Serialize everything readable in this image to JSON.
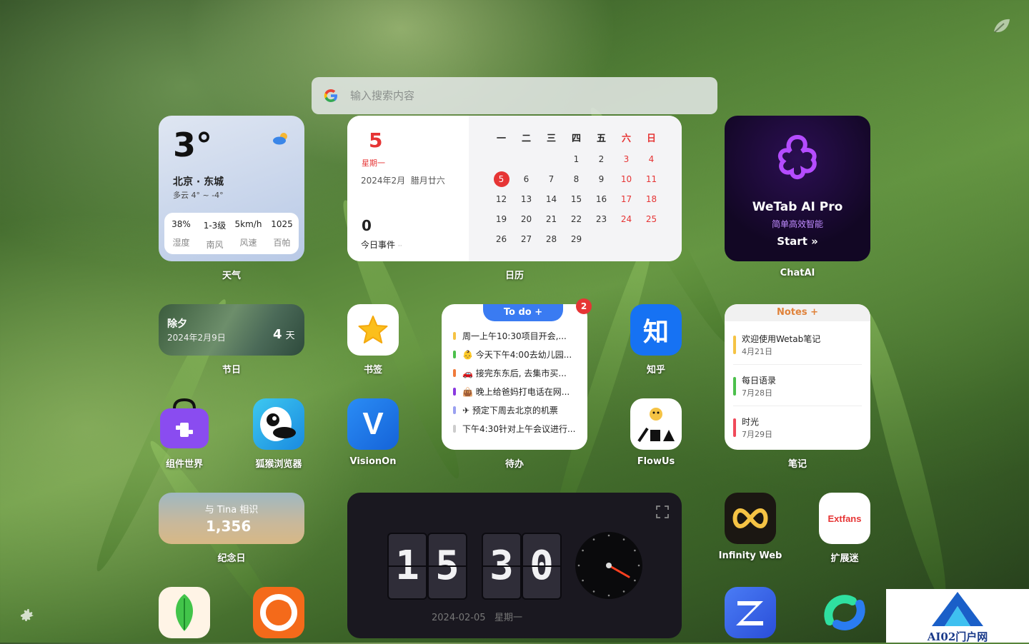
{
  "search": {
    "placeholder": "输入搜索内容"
  },
  "weather": {
    "temp": "3°",
    "city": "北京 · 东城",
    "desc": "多云 4° ~ -4°",
    "stats": [
      {
        "value": "38%",
        "label": "湿度"
      },
      {
        "value": "1-3级",
        "label": "南风"
      },
      {
        "value": "5km/h",
        "label": "风速"
      },
      {
        "value": "1025",
        "label": "百帕"
      }
    ],
    "widget_label": "天气"
  },
  "calendar": {
    "day": "5",
    "weekday": "星期一",
    "date_line": "2024年2月  腊月廿六",
    "events_count": "0",
    "events_label": "今日事件",
    "events_more": "··",
    "headers": [
      "一",
      "二",
      "三",
      "四",
      "五",
      "六",
      "日"
    ],
    "rows": [
      [
        "",
        "",
        "",
        "1",
        "2",
        "3",
        "4"
      ],
      [
        "5",
        "6",
        "7",
        "8",
        "9",
        "10",
        "11"
      ],
      [
        "12",
        "13",
        "14",
        "15",
        "16",
        "17",
        "18"
      ],
      [
        "19",
        "20",
        "21",
        "22",
        "23",
        "24",
        "25"
      ],
      [
        "26",
        "27",
        "28",
        "29",
        "",
        "",
        ""
      ]
    ],
    "today": "5",
    "widget_label": "日历"
  },
  "chatai": {
    "title": "WeTab AI Pro",
    "subtitle": "简单高效智能",
    "start": "Start »",
    "widget_label": "ChatAI"
  },
  "holiday": {
    "name": "除夕",
    "date": "2024年2月9日",
    "days": "4",
    "days_unit": "天",
    "widget_label": "节日"
  },
  "bookmark": {
    "widget_label": "书签"
  },
  "todo": {
    "tab": "To do +",
    "badge": "2",
    "items": [
      {
        "text": "周一上午10:30项目开会,...",
        "color": "#f5c344"
      },
      {
        "text": "👶 今天下午4:00去幼儿园...",
        "color": "#4cc04c"
      },
      {
        "text": "🚗 接完东东后, 去集市买...",
        "color": "#f07a3a"
      },
      {
        "text": "👜 晚上给爸妈打电话在网...",
        "color": "#8a3ae0"
      },
      {
        "text": "✈ 预定下周去北京的机票",
        "color": "#9aa0f0"
      },
      {
        "text": "下午4:30针对上午会议进行...",
        "color": "#cccccc"
      }
    ],
    "widget_label": "待办"
  },
  "zhihu": {
    "glyph": "知",
    "widget_label": "知乎"
  },
  "notes": {
    "header": "Notes +",
    "items": [
      {
        "title": "欢迎使用Wetab笔记",
        "date": "4月21日",
        "color": "#f5c344"
      },
      {
        "title": "每日语录",
        "date": "7月28日",
        "color": "#4cc04c"
      },
      {
        "title": "时光",
        "date": "7月29日",
        "color": "#f04a5a"
      }
    ],
    "widget_label": "笔记"
  },
  "apps": {
    "zujian": "组件世界",
    "huhou": "狐猴浏览器",
    "visionon": "VisionOn",
    "flowus": "FlowUs",
    "infinity": "Infinity Web",
    "extfans": "扩展迷",
    "extfans_logo": "Extfans"
  },
  "anniversary": {
    "text": "与 Tina 相识",
    "count": "1,356",
    "widget_label": "纪念日"
  },
  "clock": {
    "digits": [
      "1",
      "5",
      "3",
      "0"
    ],
    "date": "2024-02-05",
    "weekday": "星期一"
  },
  "watermark": {
    "text": "AI02门户网"
  }
}
